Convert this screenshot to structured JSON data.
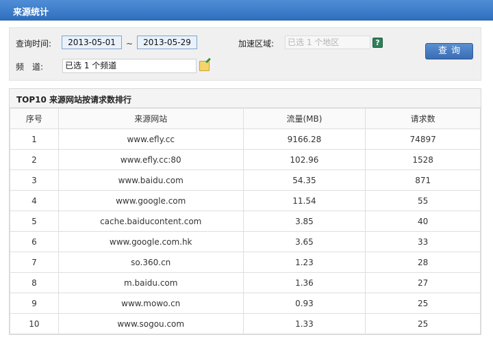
{
  "title": "来源统计",
  "query": {
    "time_label": "查询时间:",
    "date_start": "2013-05-01",
    "date_separator": "~",
    "date_end": "2013-05-29",
    "region_label": "加速区域:",
    "region_value": "已选 1 个地区",
    "channel_label": "频　道:",
    "channel_value": "已选 1 个频道",
    "button_label": "查询"
  },
  "table": {
    "title": "TOP10 来源网站按请求数排行",
    "headers": [
      "序号",
      "来源网站",
      "流量(MB)",
      "请求数"
    ],
    "rows": [
      [
        "1",
        "www.efly.cc",
        "9166.28",
        "74897"
      ],
      [
        "2",
        "www.efly.cc:80",
        "102.96",
        "1528"
      ],
      [
        "3",
        "www.baidu.com",
        "54.35",
        "871"
      ],
      [
        "4",
        "www.google.com",
        "11.54",
        "55"
      ],
      [
        "5",
        "cache.baiducontent.com",
        "3.85",
        "40"
      ],
      [
        "6",
        "www.google.com.hk",
        "3.65",
        "33"
      ],
      [
        "7",
        "so.360.cn",
        "1.23",
        "28"
      ],
      [
        "8",
        "m.baidu.com",
        "1.36",
        "27"
      ],
      [
        "9",
        "www.mowo.cn",
        "0.93",
        "25"
      ],
      [
        "10",
        "www.sogou.com",
        "1.33",
        "25"
      ]
    ]
  },
  "colors": {
    "header_blue": "#2f6fbf",
    "button_blue": "#3a6db5"
  }
}
